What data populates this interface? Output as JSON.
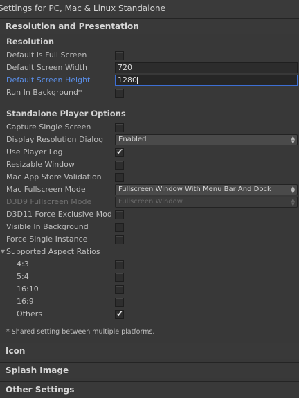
{
  "window": {
    "title": "Settings for PC, Mac & Linux Standalone"
  },
  "sections": {
    "resolution_presentation": "Resolution and Presentation",
    "icon": "Icon",
    "splash": "Splash Image",
    "other": "Other Settings"
  },
  "resolution": {
    "heading": "Resolution",
    "full_screen_label": "Default Is Full Screen",
    "full_screen_checked": false,
    "width_label": "Default Screen Width",
    "width_value": "720",
    "height_label": "Default Screen Height",
    "height_value": "1280",
    "run_bg_label": "Run In Background*",
    "run_bg_checked": false
  },
  "standalone": {
    "heading": "Standalone Player Options",
    "capture_label": "Capture Single Screen",
    "capture_checked": false,
    "display_dialog_label": "Display Resolution Dialog",
    "display_dialog_value": "Enabled",
    "player_log_label": "Use Player Log",
    "player_log_checked": true,
    "resizable_label": "Resizable Window",
    "resizable_checked": false,
    "mas_label": "Mac App Store Validation",
    "mas_checked": false,
    "mac_fs_label": "Mac Fullscreen Mode",
    "mac_fs_value": "Fullscreen Window With Menu Bar And Dock",
    "d3d9_label": "D3D9 Fullscreen Mode",
    "d3d9_value": "Fullscreen Window",
    "d3d11_label": "D3D11 Force Exclusive Mod",
    "d3d11_checked": false,
    "visible_bg_label": "Visible In Background",
    "visible_bg_checked": false,
    "single_instance_label": "Force Single Instance",
    "single_instance_checked": false
  },
  "aspect": {
    "heading": "Supported Aspect Ratios",
    "items": [
      {
        "label": "4:3",
        "checked": false
      },
      {
        "label": "5:4",
        "checked": false
      },
      {
        "label": "16:10",
        "checked": false
      },
      {
        "label": "16:9",
        "checked": false
      },
      {
        "label": "Others",
        "checked": true
      }
    ]
  },
  "footnote": "* Shared setting between multiple platforms.",
  "icons": {
    "check": "check-icon",
    "dropdown": "dropdown-arrow-icon",
    "foldout": "foldout-triangle-icon"
  },
  "colors": {
    "focus": "#5b8fe8",
    "background": "#383838"
  }
}
